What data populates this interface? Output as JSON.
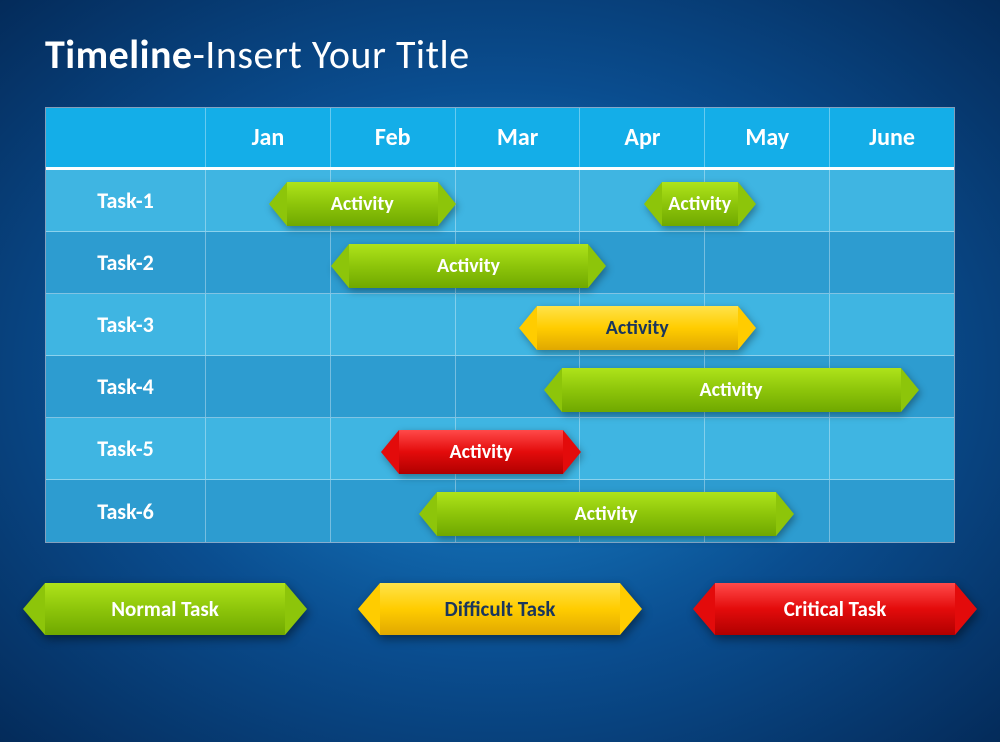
{
  "title_bold": "Timeline",
  "title_rest": "-Insert Your Title",
  "months": [
    "Jan",
    "Feb",
    "Mar",
    "Apr",
    "May",
    "June"
  ],
  "tasks": [
    "Task-1",
    "Task-2",
    "Task-3",
    "Task-4",
    "Task-5",
    "Task-6"
  ],
  "legend": {
    "normal": {
      "label": "Normal Task",
      "color": "#8dc50a"
    },
    "difficult": {
      "label": "Difficult Task",
      "color": "#ffcc00"
    },
    "critical": {
      "label": "Critical Task",
      "color": "#e30b0b"
    }
  },
  "chart_data": {
    "type": "bar",
    "orientation": "horizontal-gantt",
    "categories": [
      "Task-1",
      "Task-2",
      "Task-3",
      "Task-4",
      "Task-5",
      "Task-6"
    ],
    "x": [
      "Jan",
      "Feb",
      "Mar",
      "Apr",
      "May",
      "June"
    ],
    "xlim": [
      0.5,
      6.5
    ],
    "bars": [
      {
        "row": 0,
        "start": 1.0,
        "end": 2.5,
        "label": "Activity",
        "kind": "normal"
      },
      {
        "row": 0,
        "start": 4.0,
        "end": 4.9,
        "label": "Activity",
        "kind": "normal"
      },
      {
        "row": 1,
        "start": 1.5,
        "end": 3.7,
        "label": "Activity",
        "kind": "normal"
      },
      {
        "row": 2,
        "start": 3.0,
        "end": 4.9,
        "label": "Activity",
        "kind": "difficult"
      },
      {
        "row": 3,
        "start": 3.2,
        "end": 6.2,
        "label": "Activity",
        "kind": "normal"
      },
      {
        "row": 4,
        "start": 1.9,
        "end": 3.5,
        "label": "Activity",
        "kind": "critical"
      },
      {
        "row": 5,
        "start": 2.2,
        "end": 5.2,
        "label": "Activity",
        "kind": "normal"
      }
    ]
  }
}
